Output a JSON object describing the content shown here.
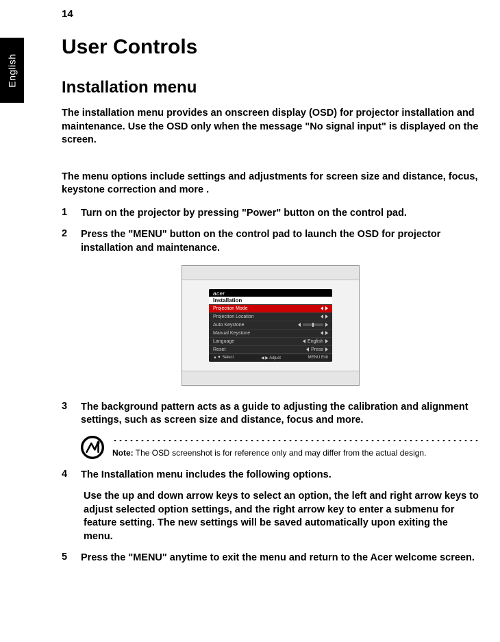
{
  "page_number": "14",
  "language_tab": "English",
  "heading_1": "User Controls",
  "heading_2": "Installation menu",
  "intro_1": "The installation menu provides an onscreen display (OSD) for projector installation and maintenance. Use the OSD only when the message \"No signal input\" is displayed on the screen.",
  "intro_2": "The menu options include settings and adjustments for screen size and distance, focus, keystone correction and more .",
  "steps": {
    "n1": "1",
    "s1a": "Turn on the projector by pressing \"",
    "s1b": "Power",
    "s1c": "\" button on the control pad.",
    "n2": "2",
    "s2a": "Press the \"",
    "s2b": "MENU",
    "s2c": "\" button on the control pad to launch the OSD for projector installation and maintenance.",
    "n3": "3",
    "s3": "The background pattern acts as a guide to adjusting the calibration and alignment settings, such as screen size and distance, focus and more.",
    "n4": "4",
    "s4": "The Installation menu includes the following options.",
    "s4_sub": "Use the up and down arrow keys to select an option, the left and right arrow keys to adjust selected option settings, and the right arrow key to enter a submenu for feature setting. The new settings will be saved automatically upon exiting the menu.",
    "n5": "5",
    "s5a": "Press the \"",
    "s5b": "MENU",
    "s5c": "\" anytime to exit the menu and return to the Acer welcome screen."
  },
  "osd": {
    "brand": "acer",
    "title": "Installation",
    "rows": [
      {
        "label": "Projection Mode",
        "value": "",
        "sel": true
      },
      {
        "label": "Projection Location",
        "value": ""
      },
      {
        "label": "Auto Keystone",
        "value": "bar"
      },
      {
        "label": "Manual Keystone",
        "value": ""
      },
      {
        "label": "Language",
        "value": "English"
      },
      {
        "label": "Reset",
        "value": "Press"
      }
    ],
    "footer_left": "▲▼ Select",
    "footer_mid": "◀ ▶ Adjust",
    "footer_right": "MENU Exit"
  },
  "note": {
    "label": "Note:",
    "text": " The OSD screenshot is for reference only and may differ from the actual design."
  }
}
